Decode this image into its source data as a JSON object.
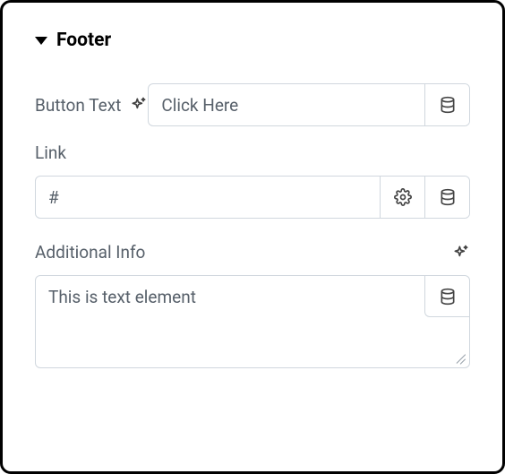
{
  "section": {
    "title": "Footer",
    "expanded": true
  },
  "fields": {
    "buttonText": {
      "label": "Button Text",
      "value": "Click Here"
    },
    "link": {
      "label": "Link",
      "value": "#"
    },
    "additionalInfo": {
      "label": "Additional Info",
      "value": "This is text element"
    }
  }
}
